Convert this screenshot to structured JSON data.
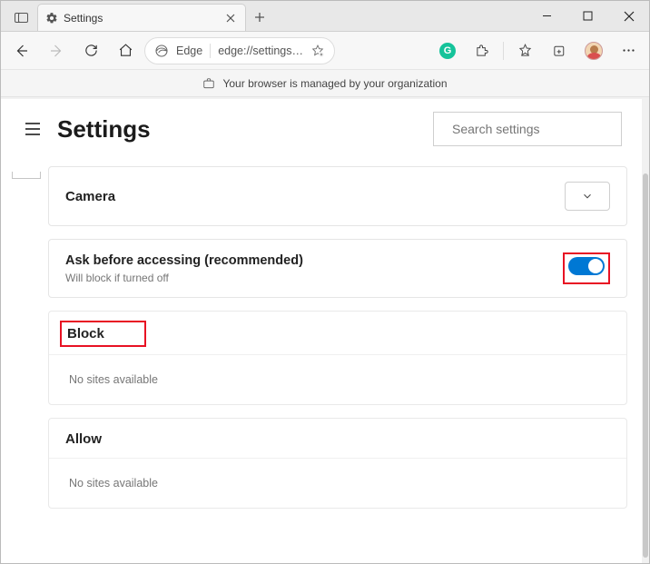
{
  "window": {
    "tab_label": "Settings",
    "address_prefix": "Edge",
    "address_url": "edge://settings…",
    "managed_text": "Your browser is managed by your organization"
  },
  "header": {
    "title": "Settings",
    "search_placeholder": "Search settings"
  },
  "camera_card": {
    "title": "Camera"
  },
  "ask_card": {
    "title": "Ask before accessing (recommended)",
    "subtitle": "Will block if turned off",
    "toggle_on": true
  },
  "block_section": {
    "title": "Block",
    "empty": "No sites available"
  },
  "allow_section": {
    "title": "Allow",
    "empty": "No sites available"
  }
}
